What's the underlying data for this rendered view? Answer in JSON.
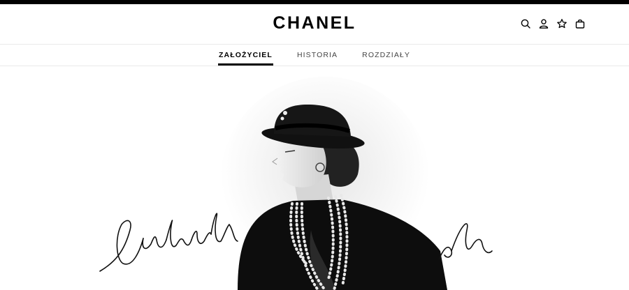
{
  "header": {
    "logo": "CHANEL",
    "icons": [
      "search-icon",
      "account-icon",
      "wishlist-star-icon",
      "shopping-bag-icon"
    ]
  },
  "subnav": {
    "tabs": [
      {
        "label": "ZAŁOŻYCIEL",
        "active": true
      },
      {
        "label": "HISTORIA",
        "active": false
      },
      {
        "label": "ROZDZIAŁY",
        "active": false
      }
    ]
  },
  "colors": {
    "brand": "#000000",
    "background": "#ffffff",
    "divider": "#eaeaea"
  }
}
